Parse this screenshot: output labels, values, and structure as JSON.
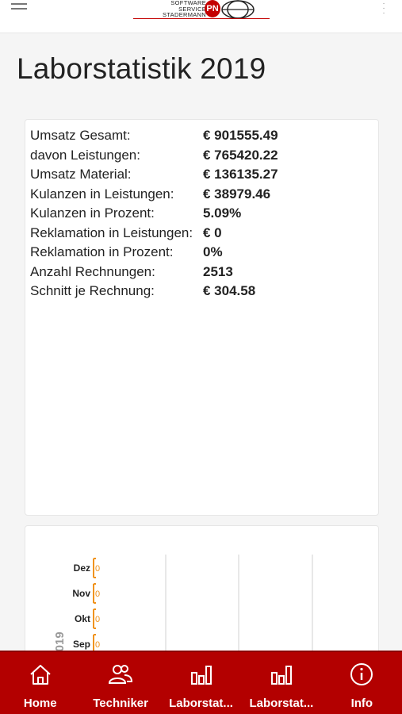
{
  "header": {
    "logo": {
      "line1": "SOFTWARE",
      "line2": "SERVICE",
      "line3": "STADERMANN",
      "mark": "PN"
    },
    "menu_icon": "menu-icon",
    "more_icon": "more-vertical-icon"
  },
  "page": {
    "title": "Laborstatistik 2019"
  },
  "stats": [
    {
      "label": "Umsatz Gesamt:",
      "value": "€ 901555.49"
    },
    {
      "label": "davon Leistungen:",
      "value": "€ 765420.22"
    },
    {
      "label": "Umsatz Material:",
      "value": "€ 136135.27"
    },
    {
      "label": "Kulanzen in Leistungen:",
      "value": "€ 38979.46"
    },
    {
      "label": "Kulanzen in Prozent:",
      "value": "5.09%"
    },
    {
      "label": "Reklamation in Leistungen:",
      "value": "€ 0"
    },
    {
      "label": "Reklamation in Prozent:",
      "value": "0%"
    },
    {
      "label": "Anzahl Rechnungen:",
      "value": "2513"
    },
    {
      "label": "Schnitt je Rechnung:",
      "value": "€ 304.58"
    }
  ],
  "chart_data": {
    "type": "bar",
    "orientation": "horizontal",
    "axis_label": "2019",
    "categories": [
      "Dez",
      "Nov",
      "Okt",
      "Sep"
    ],
    "values": [
      0,
      0,
      0,
      0
    ],
    "value_labels": [
      "0",
      "0",
      "0",
      "0"
    ],
    "bar_color": "#f0931e",
    "grid": true
  },
  "tabs": [
    {
      "label": "Home",
      "icon": "home-icon"
    },
    {
      "label": "Techniker",
      "icon": "users-icon"
    },
    {
      "label": "Laborstat...",
      "icon": "bar-chart-icon"
    },
    {
      "label": "Laborstat...",
      "icon": "bar-chart-icon"
    },
    {
      "label": "Info",
      "icon": "info-icon"
    }
  ],
  "colors": {
    "brand": "#b30000",
    "accent": "#f0931e"
  }
}
